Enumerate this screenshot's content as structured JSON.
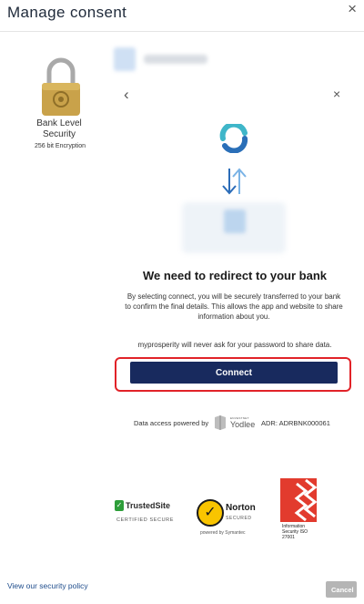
{
  "header": {
    "title": "Manage consent",
    "close_glyph": "×"
  },
  "security": {
    "line1": "Bank Level",
    "line2": "Security",
    "encryption": "256 bit Encryption"
  },
  "nav": {
    "back_glyph": "‹",
    "close_glyph": "×"
  },
  "redirect": {
    "heading": "We need to redirect to your bank",
    "description": "By selecting connect, you will be securely transferred to your bank to confirm the final details. This allows the app and website to share information about you.",
    "privacy_note": "myprosperity will never ask for your password to share data.",
    "connect_label": "Connect"
  },
  "powered": {
    "text": "Data access powered by",
    "provider_small": "ENVESTNET",
    "provider_name": "Yodlee",
    "adr": "ADR: ADRBNK000061"
  },
  "badges": {
    "trusted_title": "TrustedSite",
    "trusted_sub": "CERTIFIED SECURE",
    "norton_name": "Norton",
    "norton_sub": "SECURED",
    "norton_by": "powered by Symantec",
    "iso_lines": "Information Security ISO 27001"
  },
  "footer": {
    "policy_link": "View our security policy",
    "cancel_label": "Cancel"
  },
  "colors": {
    "primary": "#182a5e",
    "highlight": "#e12228",
    "link": "#1f4d8c",
    "cancel": "#b5b5b5"
  }
}
